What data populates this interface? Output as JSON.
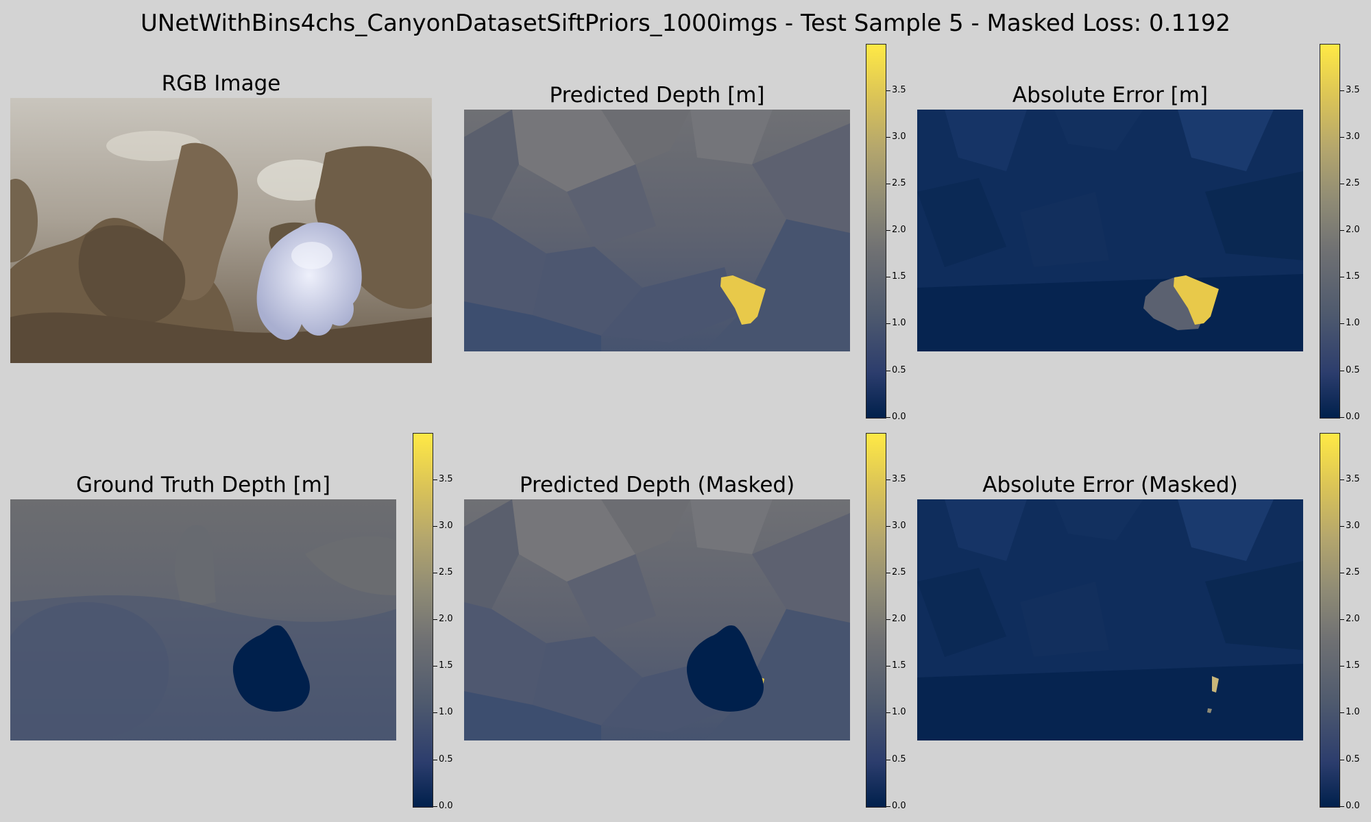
{
  "figure": {
    "title": "UNetWithBins4chs_CanyonDatasetSiftPriors_1000imgs - Test Sample 5 - Masked Loss: 0.1192"
  },
  "panels": {
    "rgb": {
      "title": "RGB Image"
    },
    "pred": {
      "title": "Predicted Depth [m]"
    },
    "abs_err": {
      "title": "Absolute Error [m]"
    },
    "gt": {
      "title": "Ground Truth Depth [m]"
    },
    "pred_masked": {
      "title": "Predicted Depth (Masked)"
    },
    "abs_err_masked": {
      "title": "Absolute Error (Masked)"
    }
  },
  "colorbar": {
    "colormap": "cividis",
    "min": 0.0,
    "max": 3.95,
    "ticks": [
      "0.0",
      "0.5",
      "1.0",
      "1.5",
      "2.0",
      "2.5",
      "3.0",
      "3.5"
    ]
  },
  "colors": {
    "background": "#d3d3d3",
    "cmap_low": "#00204c",
    "cmap_mid": "#707173",
    "cmap_high": "#ffe945"
  }
}
